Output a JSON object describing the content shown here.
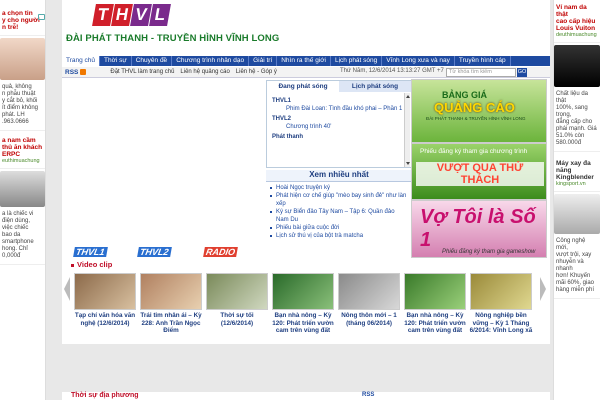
{
  "colors": {
    "nav_blue": "#1e4aa0",
    "brand_red": "#d01f2a",
    "brand_purple": "#7a2a8c",
    "station_green": "#1a7b2b"
  },
  "left_ads": [
    {
      "title": "a chọn tin\ny cho người\nn trễ!",
      "text": "",
      "site": ""
    },
    {
      "title": "",
      "text": "quả, không\nn phẫu thuật\ny cắt bỏ, khối\nít điểm không\nphát. LH\n.963.0666",
      "site": ""
    },
    {
      "title": "a nam cầm\nthủ ăn khách\nERPC",
      "text": "",
      "site": "euthimuachung"
    },
    {
      "title": "",
      "text": "a là chiếc vi\nđiện dùng,\nviệc chiếc\nbao da\nsmartphone\nhong. Chỉ\n0,000đ",
      "site": ""
    }
  ],
  "right_ads": [
    {
      "title": "Ví nam da thật\ncao cấp hiệu\nLouis Vuiton",
      "text": "",
      "site": "deuthimuachung"
    },
    {
      "title": "",
      "text": "Chất liệu da thật\n100%, sang trọng,\nđẳng cấp cho\nphái mạnh. Giá\n51.0% còn 580.000đ",
      "site": ""
    },
    {
      "title": "Máy xay đa\nnăng\nKingblender",
      "text": "",
      "site": "kingsport.vn"
    },
    {
      "title": "",
      "text": "Công nghệ mới,\nvượt trội, xay\nnhuyễn và nhanh\nhơn! Khuyến\nmãi 60%, giao\nhàng miễn phí",
      "site": ""
    }
  ],
  "header": {
    "logo_letters": [
      "T",
      "H",
      "V",
      "L"
    ],
    "station_name": "ĐÀI PHÁT THANH - TRUYỀN HÌNH VĨNH LONG"
  },
  "nav": [
    "Trang chủ",
    "Thời sự",
    "Chuyên đề",
    "Chương trình nhân dạo",
    "Giải trí",
    "Nhìn ra thế giới",
    "Lịch phát sóng",
    "Vĩnh Long xưa và nay",
    "Truyền hình cáp"
  ],
  "subbar": {
    "rss": "RSS",
    "links": [
      "Đặt THVL làm trang chủ",
      "Liên hệ quảng cáo",
      "Liên hệ - Góp ý"
    ],
    "date": "Thứ Năm, 12/6/2014 13:13:27 GMT +7",
    "search_placeholder": "Từ khóa tìm kiếm",
    "go": "GO"
  },
  "live": {
    "tabs": [
      "Đang phát sóng",
      "Lịch phát sóng"
    ],
    "channels": [
      {
        "name": "THVL1",
        "program": "Phim Đài Loan: Tình đầu khó phai – Phần 1"
      },
      {
        "name": "THVL2",
        "program": "Chương trình 40'"
      },
      {
        "name": "Phát thanh",
        "program": ""
      }
    ]
  },
  "most_viewed": {
    "title": "Xem nhiều nhất",
    "items": [
      "Hoài Ngọc truyện ký",
      "Phát hiện cơ chế giúp \"mèo bay sinh đẻ\" như làn xếp",
      "Ký sự Biển đảo Tây Nam – Tập 6: Quần đảo Nam Du",
      "Phiếu bài giữa cuộc đời",
      "Lịch sử thú vị của bột trà matcha"
    ]
  },
  "promos": {
    "p1_line1": "BẢNG GIÁ",
    "p1_line2": "QUẢNG CÁO",
    "p1_line3": "ĐÀI PHÁT THANH & TRUYỀN HÌNH VĨNH LONG",
    "p2_line1": "Phiếu đăng ký tham gia chương trình",
    "p2_line2": "VƯỢT QUA THỬ THÁCH",
    "p3_line1": "Vợ Tôi là Số 1",
    "p3_line2": "Phiếu đăng ký tham gia gameshow"
  },
  "channels": [
    "THVL1",
    "THVL2",
    "RADIO"
  ],
  "video": {
    "heading": "Video clip",
    "items": [
      {
        "caption": "Tạp chí văn hóa văn nghệ (12/6/2014)",
        "color": "#8c6a4a"
      },
      {
        "caption": "Trái tim nhân ái – Kỳ 228: Anh Trần Ngọc Điểm",
        "color": "#b08060"
      },
      {
        "caption": "Thời sự tối (12/6/2014)",
        "color": "#7a8a5a"
      },
      {
        "caption": "Bạn nhà nông – Kỳ 120: Phát triển vườn cam trên vùng đất",
        "color": "#4a8a3a"
      },
      {
        "caption": "Nông thôn mới – 1 (tháng 06/2014)",
        "color": "#8a8a8a"
      },
      {
        "caption": "Bạn nhà nông – Kỳ 120: Phát triển vườn cam trên vùng đất",
        "color": "#5a9a4a"
      },
      {
        "caption": "Nông nghiệp bền vững – Kỳ 1 Tháng 6/2014: Vĩnh Long xã",
        "color": "#9a8a3a"
      }
    ]
  },
  "news": {
    "heading": "Thời sự địa phương",
    "rss": "RSS"
  }
}
